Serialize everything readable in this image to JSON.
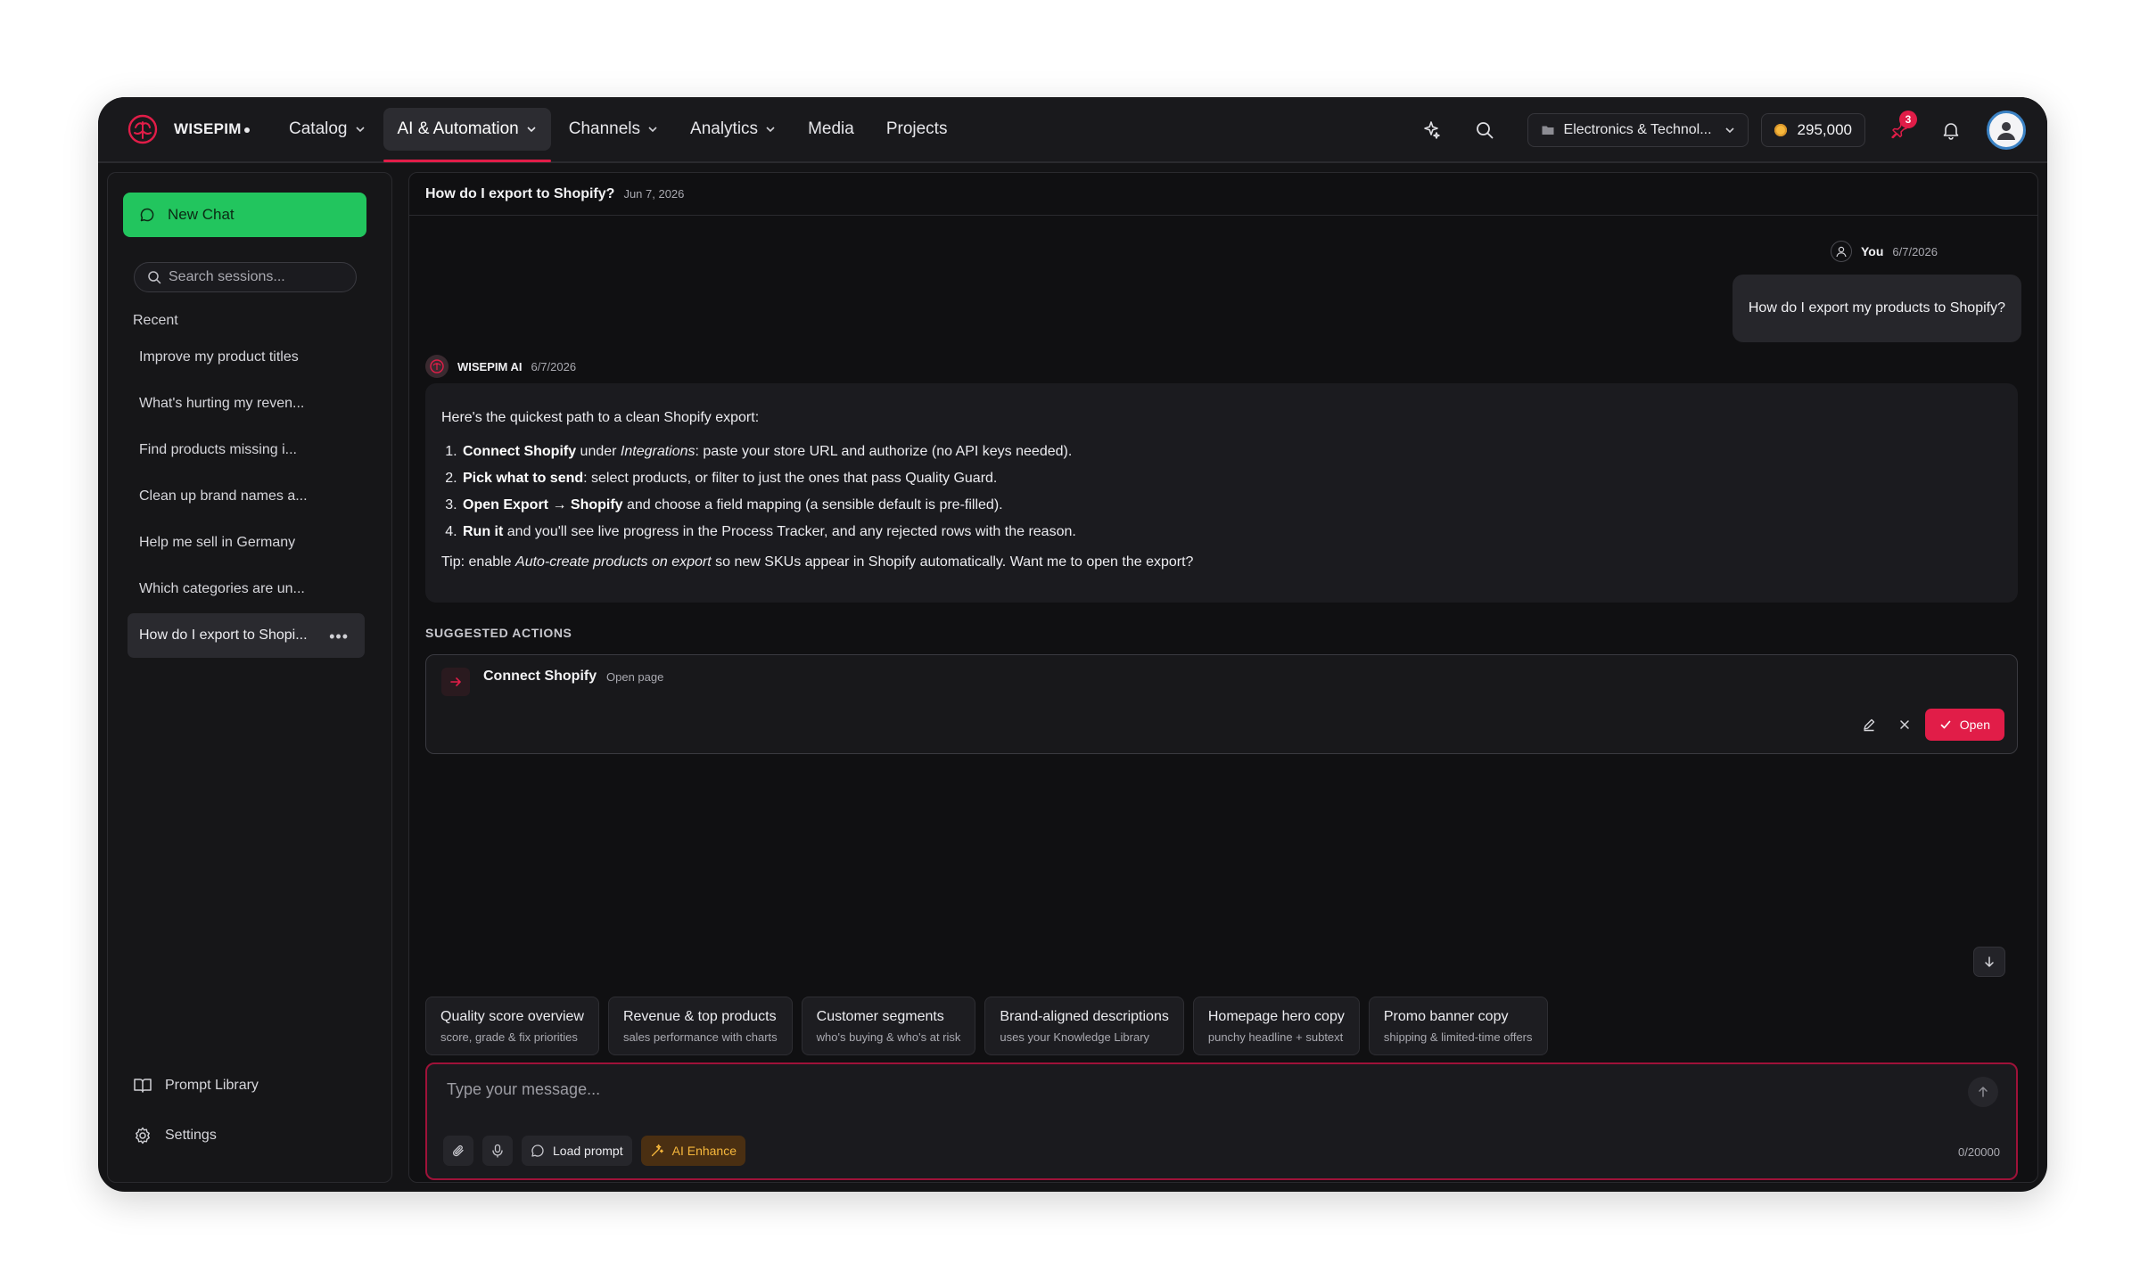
{
  "app": {
    "brand": "WISEPIM"
  },
  "nav": {
    "items": [
      {
        "label": "Catalog",
        "dropdown": true
      },
      {
        "label": "AI & Automation",
        "dropdown": true,
        "active": true
      },
      {
        "label": "Channels",
        "dropdown": true
      },
      {
        "label": "Analytics",
        "dropdown": true
      },
      {
        "label": "Media",
        "dropdown": false
      },
      {
        "label": "Projects",
        "dropdown": false
      }
    ]
  },
  "topbar": {
    "store": "Electronics & Technol...",
    "credits": "295,000",
    "notification_count": "3",
    "icons": [
      "sparkles-icon",
      "search-icon",
      "pin-icon",
      "bell-icon",
      "user-icon"
    ]
  },
  "sidebar": {
    "new_chat": "New Chat",
    "search_placeholder": "Search sessions...",
    "recent_label": "Recent",
    "sessions": [
      "Improve my product titles",
      "What's hurting my reven...",
      "Find products missing i...",
      "Clean up brand names a...",
      "Help me sell in Germany",
      "Which categories are un...",
      "How do I export to Shopi..."
    ],
    "footer": {
      "prompt_library": "Prompt Library",
      "settings": "Settings"
    }
  },
  "chat": {
    "title": "How do I export to Shopify?",
    "date": "Jun 7, 2026",
    "user": {
      "name": "You",
      "date": "6/7/2026",
      "message": "How do I export my products to Shopify?"
    },
    "ai": {
      "name": "WISEPIM AI",
      "date": "6/7/2026",
      "intro": "Here's the quickest path to a clean Shopify export:",
      "steps": [
        {
          "b": "Connect Shopify",
          "t1": " under ",
          "i": "Integrations",
          "t2": ": paste your store URL and authorize (no API keys needed)."
        },
        {
          "b": "Pick what to send",
          "t1": ": select products, or filter to just the ones that pass Quality Guard.",
          "i": "",
          "t2": ""
        },
        {
          "b": "Open Export → Shopify",
          "t1": " and choose a field mapping (a sensible default is pre-filled).",
          "i": "",
          "t2": ""
        },
        {
          "b": "Run it",
          "t1": " and you'll see live progress in the Process Tracker, and any rejected rows with the reason.",
          "i": "",
          "t2": ""
        }
      ],
      "tip_pre": "Tip: enable ",
      "tip_em": "Auto-create products on export",
      "tip_post": " so new SKUs appear in Shopify automatically. Want me to open the export?"
    },
    "suggested": {
      "label": "SUGGESTED ACTIONS",
      "name": "Connect Shopify",
      "type": "Open page",
      "open": "Open"
    }
  },
  "chips": [
    {
      "title": "Quality score overview",
      "sub": "score, grade & fix priorities"
    },
    {
      "title": "Revenue & top products",
      "sub": "sales performance with charts"
    },
    {
      "title": "Customer segments",
      "sub": "who's buying & who's at risk"
    },
    {
      "title": "Brand-aligned descriptions",
      "sub": "uses your Knowledge Library"
    },
    {
      "title": "Homepage hero copy",
      "sub": "punchy headline + subtext"
    },
    {
      "title": "Promo banner copy",
      "sub": "shipping & limited-time offers"
    }
  ],
  "composer": {
    "placeholder": "Type your message...",
    "load_prompt": "Load prompt",
    "ai_enhance": "AI Enhance",
    "counter": "0/20000"
  },
  "colors": {
    "accent": "#e11d48",
    "green": "#22c55e",
    "bg": "#141416"
  }
}
